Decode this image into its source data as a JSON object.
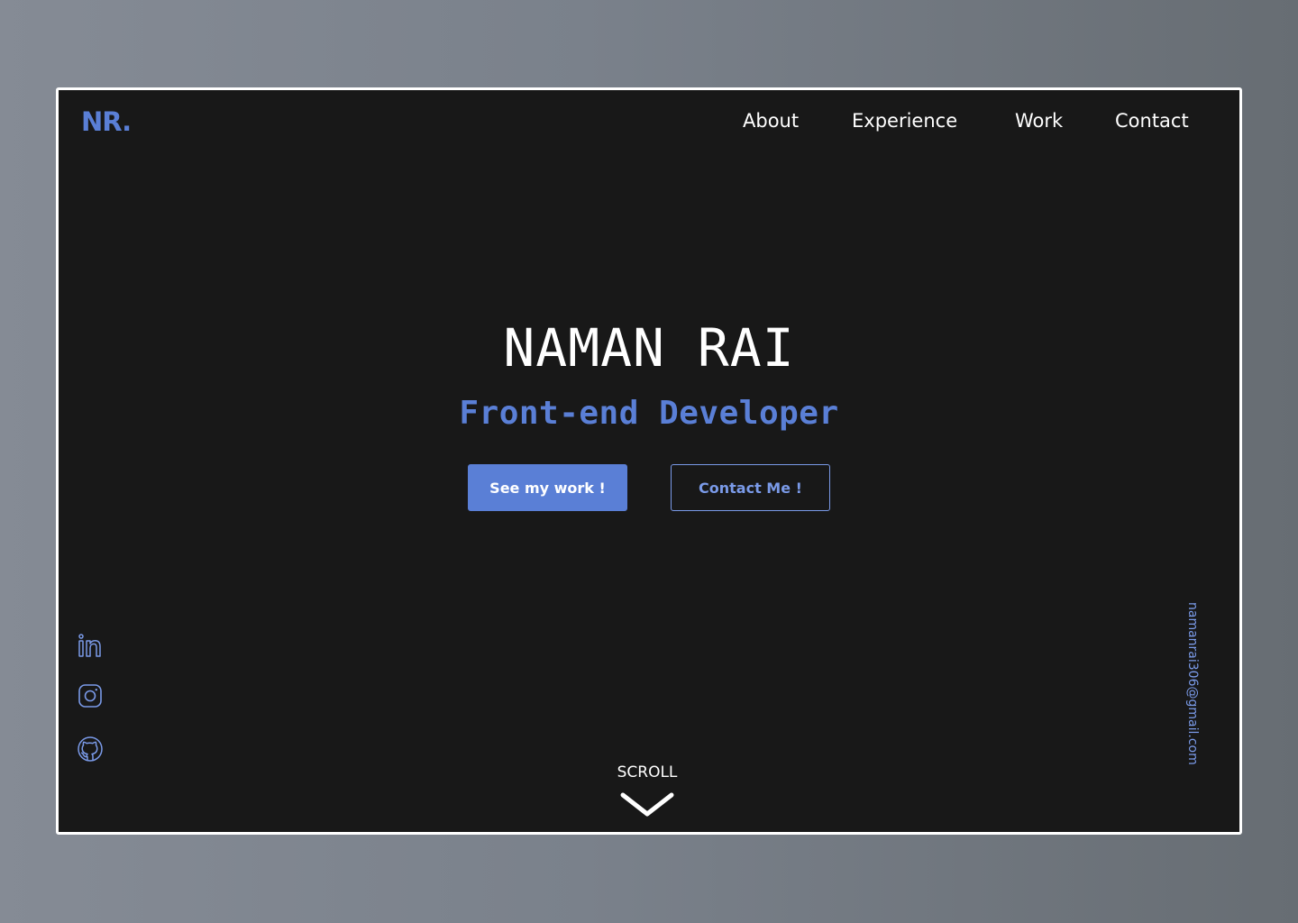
{
  "brand": {
    "logo": "NR.",
    "accent_color": "#5a7fd6"
  },
  "nav": {
    "items": [
      {
        "label": "About"
      },
      {
        "label": "Experience"
      },
      {
        "label": "Work"
      },
      {
        "label": "Contact"
      }
    ]
  },
  "hero": {
    "name": "NAMAN RAI",
    "role": "Front-end Developer",
    "primary_button": "See my work !",
    "secondary_button": "Contact Me !"
  },
  "social": {
    "links": [
      {
        "icon": "linkedin-icon"
      },
      {
        "icon": "instagram-icon"
      },
      {
        "icon": "github-icon"
      }
    ]
  },
  "contact": {
    "email": "namanrai306@gmail.com"
  },
  "scroll": {
    "label": "SCROLL",
    "icon": "chevron-down-icon"
  }
}
